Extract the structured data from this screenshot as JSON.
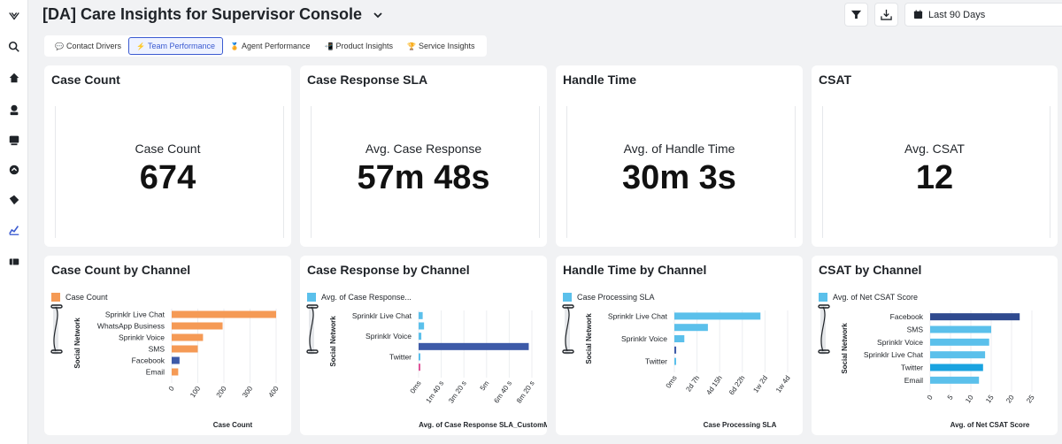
{
  "header": {
    "title": "[DA] Care Insights for Supervisor Console",
    "date_range": "Last 90 Days"
  },
  "tabs": [
    {
      "label": "Contact Drivers",
      "icon": "speech-bubble-icon"
    },
    {
      "label": "Team Performance",
      "icon": "lightning-icon",
      "active": true
    },
    {
      "label": "Agent Performance",
      "icon": "medal-icon"
    },
    {
      "label": "Product Insights",
      "icon": "phone-icon"
    },
    {
      "label": "Service Insights",
      "icon": "trophy-icon"
    }
  ],
  "kpis": [
    {
      "title": "Case Count",
      "label": "Case Count",
      "value": "674"
    },
    {
      "title": "Case Response SLA",
      "label": "Avg. Case Response",
      "value": "57m 48s"
    },
    {
      "title": "Handle Time",
      "label": "Avg. of Handle Time",
      "value": "30m 3s"
    },
    {
      "title": "CSAT",
      "label": "Avg. CSAT",
      "value": "12"
    }
  ],
  "chart_data": [
    {
      "type": "bar",
      "orientation": "horizontal",
      "title": "Case Count by Channel",
      "legend": "Case Count",
      "ylabel": "Social Network",
      "xlabel": "Case Count",
      "color": "#f59a55",
      "categories": [
        "Sprinklr Live Chat",
        "WhatsApp Business",
        "Sprinklr Voice",
        "SMS",
        "Facebook",
        "Email"
      ],
      "values": [
        400,
        195,
        120,
        100,
        30,
        25
      ],
      "bar_colors": [
        "#f59a55",
        "#f59a55",
        "#f59a55",
        "#f59a55",
        "#3d5aa8",
        "#f59a55"
      ],
      "ticks": [
        "0",
        "100",
        "200",
        "300",
        "400"
      ],
      "xlim": [
        0,
        400
      ]
    },
    {
      "type": "bar",
      "orientation": "horizontal",
      "title": "Case Response by Channel",
      "legend": "Avg. of Case Response...",
      "ylabel": "Social Network",
      "xlabel": "Avg. of Case Response SLA_CustomM",
      "color": "#5bc0eb",
      "categories": [
        "Sprinklr Live Chat",
        "Sprinklr Voice",
        "Twitter"
      ],
      "label_rows": [
        0,
        2,
        4
      ],
      "rows": [
        {
          "value": 0.3,
          "color": "#5bc0eb"
        },
        {
          "value": 0.4,
          "color": "#5bc0eb"
        },
        {
          "value": 0.2,
          "color": "#5bc0eb"
        },
        {
          "value": 8.1,
          "color": "#3d5aa8"
        },
        {
          "value": 0.1,
          "color": "#5bc0eb"
        },
        {
          "value": 0.1,
          "color": "#e0559a"
        }
      ],
      "ticks": [
        "0ms",
        "1m 40 s",
        "3m 20 s",
        "5m",
        "6m 40 s",
        "8m 20 s"
      ],
      "xlim": [
        0,
        8.33
      ]
    },
    {
      "type": "bar",
      "orientation": "horizontal",
      "title": "Handle Time by Channel",
      "legend": "Case Processing SLA",
      "ylabel": "Social Network",
      "xlabel": "Case Processing SLA",
      "color": "#5bc0eb",
      "categories": [
        "Sprinklr Live Chat",
        "Sprinklr Voice",
        "Twitter"
      ],
      "label_rows": [
        0,
        2,
        4
      ],
      "rows": [
        {
          "value": 1.9,
          "color": "#5bc0eb"
        },
        {
          "value": 0.74,
          "color": "#5bc0eb"
        },
        {
          "value": 0.22,
          "color": "#5bc0eb"
        },
        {
          "value": 0.04,
          "color": "#3d5aa8"
        },
        {
          "value": 0.03,
          "color": "#5bc0eb"
        }
      ],
      "ticks": [
        "0ms",
        "2d 7h",
        "4d 15h",
        "6d 22h",
        "1w 2d",
        "1w 4d"
      ],
      "xlim": [
        0,
        2.5
      ]
    },
    {
      "type": "bar",
      "orientation": "horizontal",
      "title": "CSAT by Channel",
      "legend": "Avg. of Net CSAT Score",
      "ylabel": "Social Network",
      "xlabel": "Avg. of Net CSAT Score",
      "color": "#5bc0eb",
      "categories": [
        "Facebook",
        "SMS",
        "Sprinklr Voice",
        "Sprinklr Live Chat",
        "Twitter",
        "Email"
      ],
      "values": [
        22,
        15,
        14.5,
        13.5,
        13,
        12
      ],
      "bar_colors": [
        "#2f4a8f",
        "#5bc0eb",
        "#5bc0eb",
        "#5bc0eb",
        "#1aa3e0",
        "#5bc0eb"
      ],
      "ticks": [
        "0",
        "5",
        "10",
        "15",
        "20",
        "25"
      ],
      "xlim": [
        0,
        25
      ]
    }
  ]
}
